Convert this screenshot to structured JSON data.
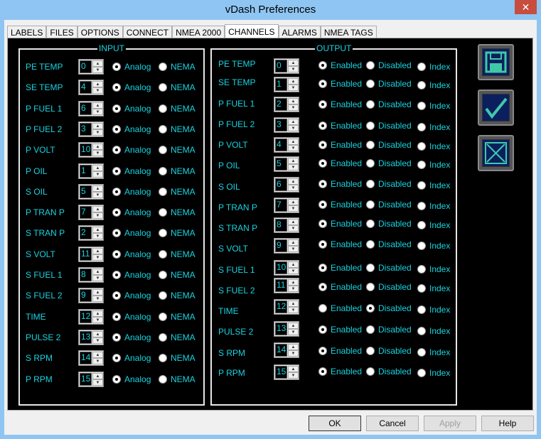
{
  "window": {
    "title": "vDash Preferences",
    "close": "✕"
  },
  "tabs": [
    "LABELS",
    "FILES",
    "OPTIONS",
    "CONNECT",
    "NMEA 2000",
    "CHANNELS",
    "ALARMS",
    "NMEA TAGS"
  ],
  "active_tab": "CHANNELS",
  "input": {
    "title": "INPUT",
    "opt1": "Analog",
    "opt2": "NEMA",
    "rows": [
      {
        "label": "PE TEMP",
        "value": "0",
        "sel": "Analog"
      },
      {
        "label": "SE TEMP",
        "value": "4",
        "sel": "Analog"
      },
      {
        "label": "P FUEL 1",
        "value": "6",
        "sel": "Analog"
      },
      {
        "label": "P FUEL 2",
        "value": "3",
        "sel": "Analog"
      },
      {
        "label": "P VOLT",
        "value": "10",
        "sel": "Analog"
      },
      {
        "label": "P OIL",
        "value": "1",
        "sel": "Analog"
      },
      {
        "label": "S OIL",
        "value": "5",
        "sel": "Analog"
      },
      {
        "label": "P TRAN P",
        "value": "7",
        "sel": "Analog"
      },
      {
        "label": "S TRAN P",
        "value": "2",
        "sel": "Analog"
      },
      {
        "label": "S VOLT",
        "value": "11",
        "sel": "Analog"
      },
      {
        "label": "S FUEL 1",
        "value": "8",
        "sel": "Analog"
      },
      {
        "label": "S FUEL 2",
        "value": "9",
        "sel": "Analog"
      },
      {
        "label": "TIME",
        "value": "12",
        "sel": "Analog"
      },
      {
        "label": "PULSE 2",
        "value": "13",
        "sel": "Analog"
      },
      {
        "label": "S RPM",
        "value": "14",
        "sel": "Analog"
      },
      {
        "label": "P RPM",
        "value": "15",
        "sel": "Analog"
      }
    ]
  },
  "output": {
    "title": "OUTPUT",
    "opt1": "Enabled",
    "opt2": "Disabled",
    "opt3": "Index",
    "rows": [
      {
        "label": "PE TEMP",
        "value": "0",
        "sel": "Enabled"
      },
      {
        "label": "SE TEMP",
        "value": "1",
        "sel": "Enabled"
      },
      {
        "label": "P FUEL 1",
        "value": "2",
        "sel": "Enabled"
      },
      {
        "label": "P FUEL 2",
        "value": "3",
        "sel": "Enabled"
      },
      {
        "label": "P VOLT",
        "value": "4",
        "sel": "Enabled"
      },
      {
        "label": "P OIL",
        "value": "5",
        "sel": "Enabled"
      },
      {
        "label": "S OIL",
        "value": "6",
        "sel": "Enabled"
      },
      {
        "label": "P TRAN P",
        "value": "7",
        "sel": "Enabled"
      },
      {
        "label": "S TRAN P",
        "value": "8",
        "sel": "Enabled"
      },
      {
        "label": "S VOLT",
        "value": "9",
        "sel": "Enabled"
      },
      {
        "label": "S FUEL 1",
        "value": "10",
        "sel": "Enabled"
      },
      {
        "label": "S FUEL 2",
        "value": "11",
        "sel": "Enabled"
      },
      {
        "label": "TIME",
        "value": "12",
        "sel": "Disabled"
      },
      {
        "label": "PULSE 2",
        "value": "13",
        "sel": "Enabled"
      },
      {
        "label": "S RPM",
        "value": "14",
        "sel": "Enabled"
      },
      {
        "label": "P RPM",
        "value": "15",
        "sel": "Enabled"
      }
    ]
  },
  "buttons": {
    "ok": "OK",
    "cancel": "Cancel",
    "apply": "Apply",
    "help": "Help"
  },
  "colors": {
    "text": "#19d3e0",
    "panel": "#000000",
    "icon_face": "#0b1f5e",
    "icon_glyph": "#3fc9a8"
  }
}
